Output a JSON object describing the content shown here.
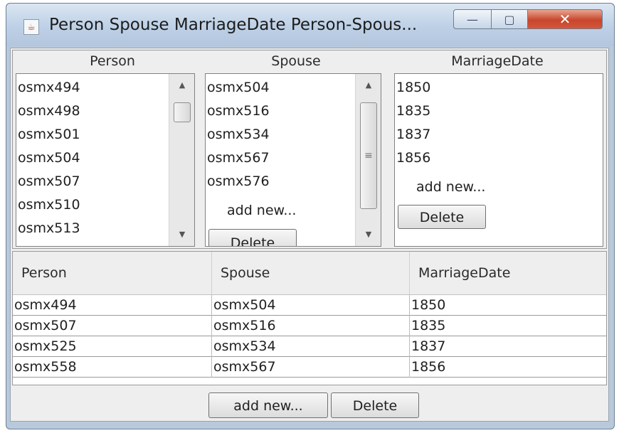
{
  "window": {
    "title": "Person Spouse MarriageDate Person-Spous...",
    "icon": "java-icon",
    "controls": {
      "minimize": "—",
      "maximize": "▢",
      "close": "✕"
    }
  },
  "lists": {
    "person": {
      "header": "Person",
      "items": [
        "osmx494",
        "osmx498",
        "osmx501",
        "osmx504",
        "osmx507",
        "osmx510",
        "osmx513"
      ]
    },
    "spouse": {
      "header": "Spouse",
      "items": [
        "osmx504",
        "osmx516",
        "osmx534",
        "osmx567",
        "osmx576"
      ],
      "add_new": "add new...",
      "delete": "Delete"
    },
    "marriage_date": {
      "header": "MarriageDate",
      "items": [
        "1850",
        "1835",
        "1837",
        "1856"
      ],
      "add_new": "add new...",
      "delete": "Delete"
    }
  },
  "table": {
    "columns": [
      "Person",
      "Spouse",
      "MarriageDate"
    ],
    "rows": [
      [
        "osmx494",
        "osmx504",
        "1850"
      ],
      [
        "osmx507",
        "osmx516",
        "1835"
      ],
      [
        "osmx525",
        "osmx534",
        "1837"
      ],
      [
        "osmx558",
        "osmx567",
        "1856"
      ]
    ]
  },
  "footer": {
    "add_new": "add new...",
    "delete": "Delete"
  },
  "colors": {
    "titlebar": "#bdd0e6",
    "close_button": "#c8462c",
    "panel_bg": "#eeeeee"
  }
}
